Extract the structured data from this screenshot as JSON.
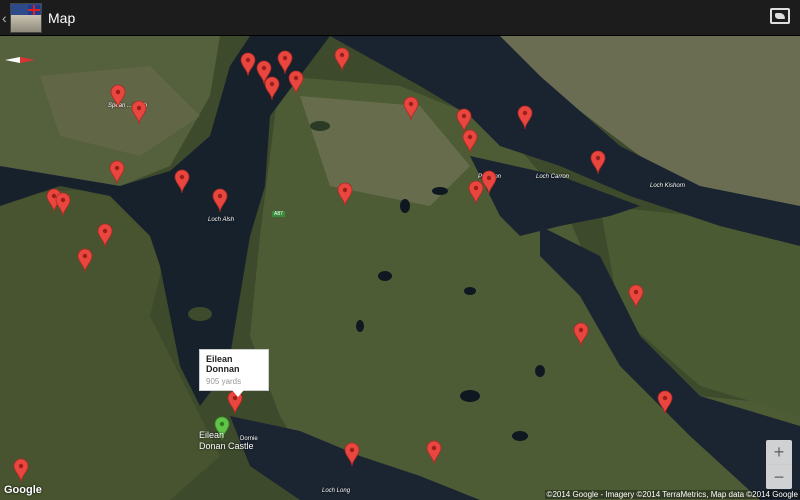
{
  "actionbar": {
    "title": "Map",
    "app_icon": "app-launcher-icon",
    "map_type_icon": "map-type-icon"
  },
  "map": {
    "info_window": {
      "title": "Eilean Donnan",
      "distance": "905 yards"
    },
    "castle_label_line1": "Eilean",
    "castle_label_line2": "Donan Castle",
    "dornie_label": "Dornie",
    "place_labels": [
      "Loch Alsh",
      "Loch Carron",
      "Loch Kishorn",
      "Loch Long",
      "Plockton",
      "Spean ...earch"
    ],
    "road_sign": "A87",
    "zoom_in": "+",
    "zoom_out": "−",
    "google_logo": "Google",
    "attribution": "©2014 Google - Imagery ©2014 TerraMetrics, Map data ©2014 Google",
    "marker_color": "#e8463e",
    "selected_marker_color": "#5fc447"
  }
}
